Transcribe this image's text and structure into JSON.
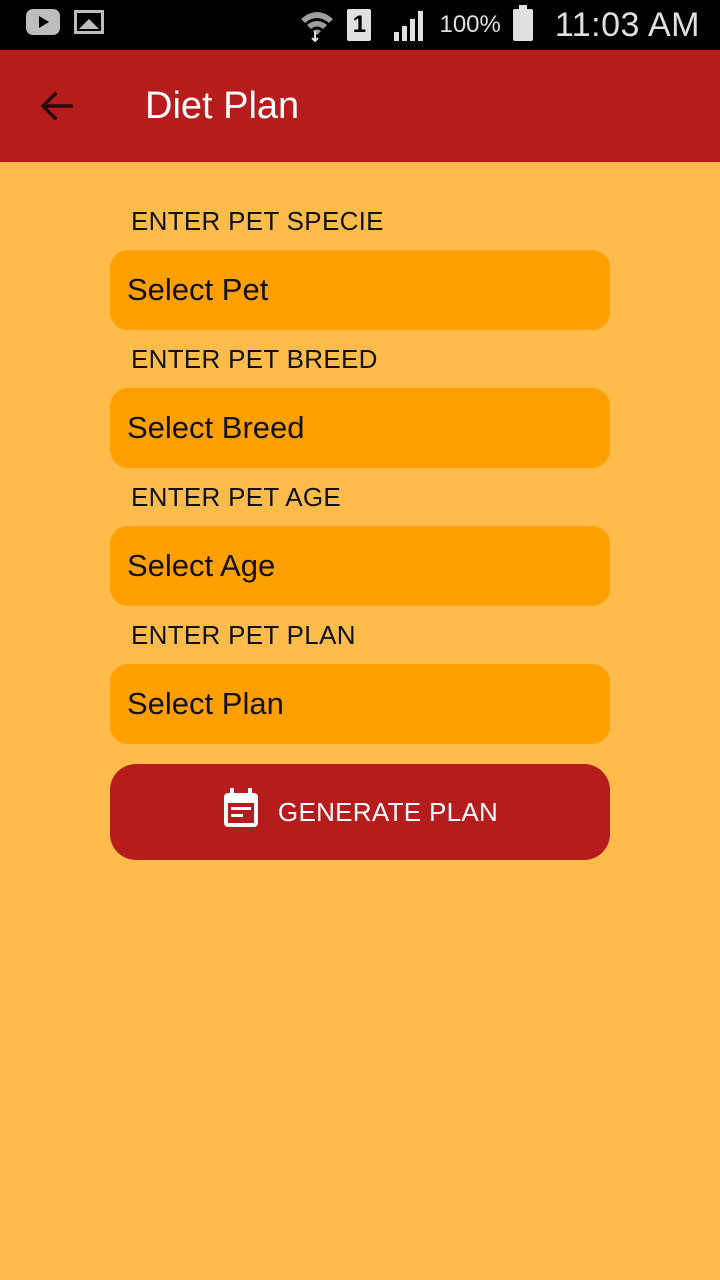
{
  "status_bar": {
    "icons": [
      "youtube-icon",
      "gallery-icon",
      "wifi-icon",
      "sim-1-icon",
      "signal-icon",
      "battery-icon"
    ],
    "sim_number": "1",
    "battery": "100%",
    "time": "11:03 AM"
  },
  "app_bar": {
    "back_icon": "arrow-back-icon",
    "title": "Diet Plan",
    "color": "#B71C1C"
  },
  "form": {
    "fields": [
      {
        "label": "ENTER PET SPECIE",
        "value": "Select Pet"
      },
      {
        "label": "ENTER PET BREED",
        "value": "Select Breed"
      },
      {
        "label": "ENTER PET AGE",
        "value": "Select Age"
      },
      {
        "label": "ENTER PET PLAN",
        "value": "Select Plan"
      }
    ],
    "generate_button": {
      "icon": "calendar-icon",
      "label": "GENERATE PLAN"
    }
  },
  "colors": {
    "background": "#FFBC4B",
    "select_fill": "#FF9F00",
    "accent": "#B71C1C"
  }
}
